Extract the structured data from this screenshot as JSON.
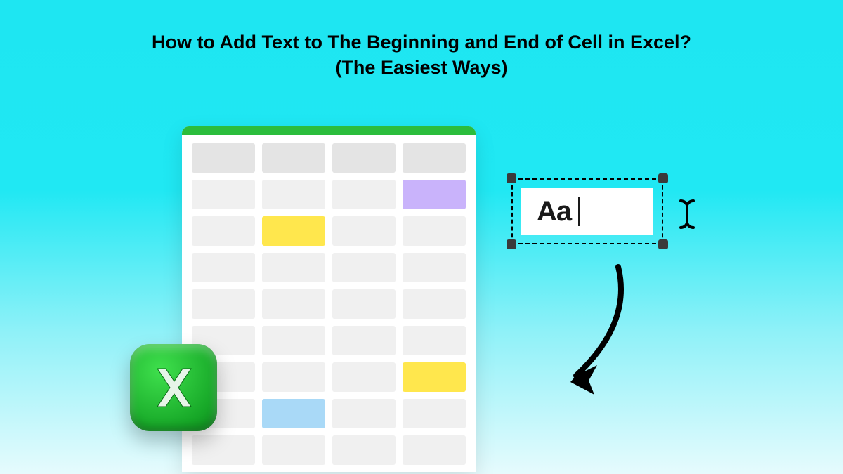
{
  "title_line1": "How to Add Text to The Beginning and End of Cell in Excel?",
  "title_line2": "(The Easiest Ways)",
  "textbox": {
    "content": "Aa"
  },
  "excel_icon_letter": "X"
}
